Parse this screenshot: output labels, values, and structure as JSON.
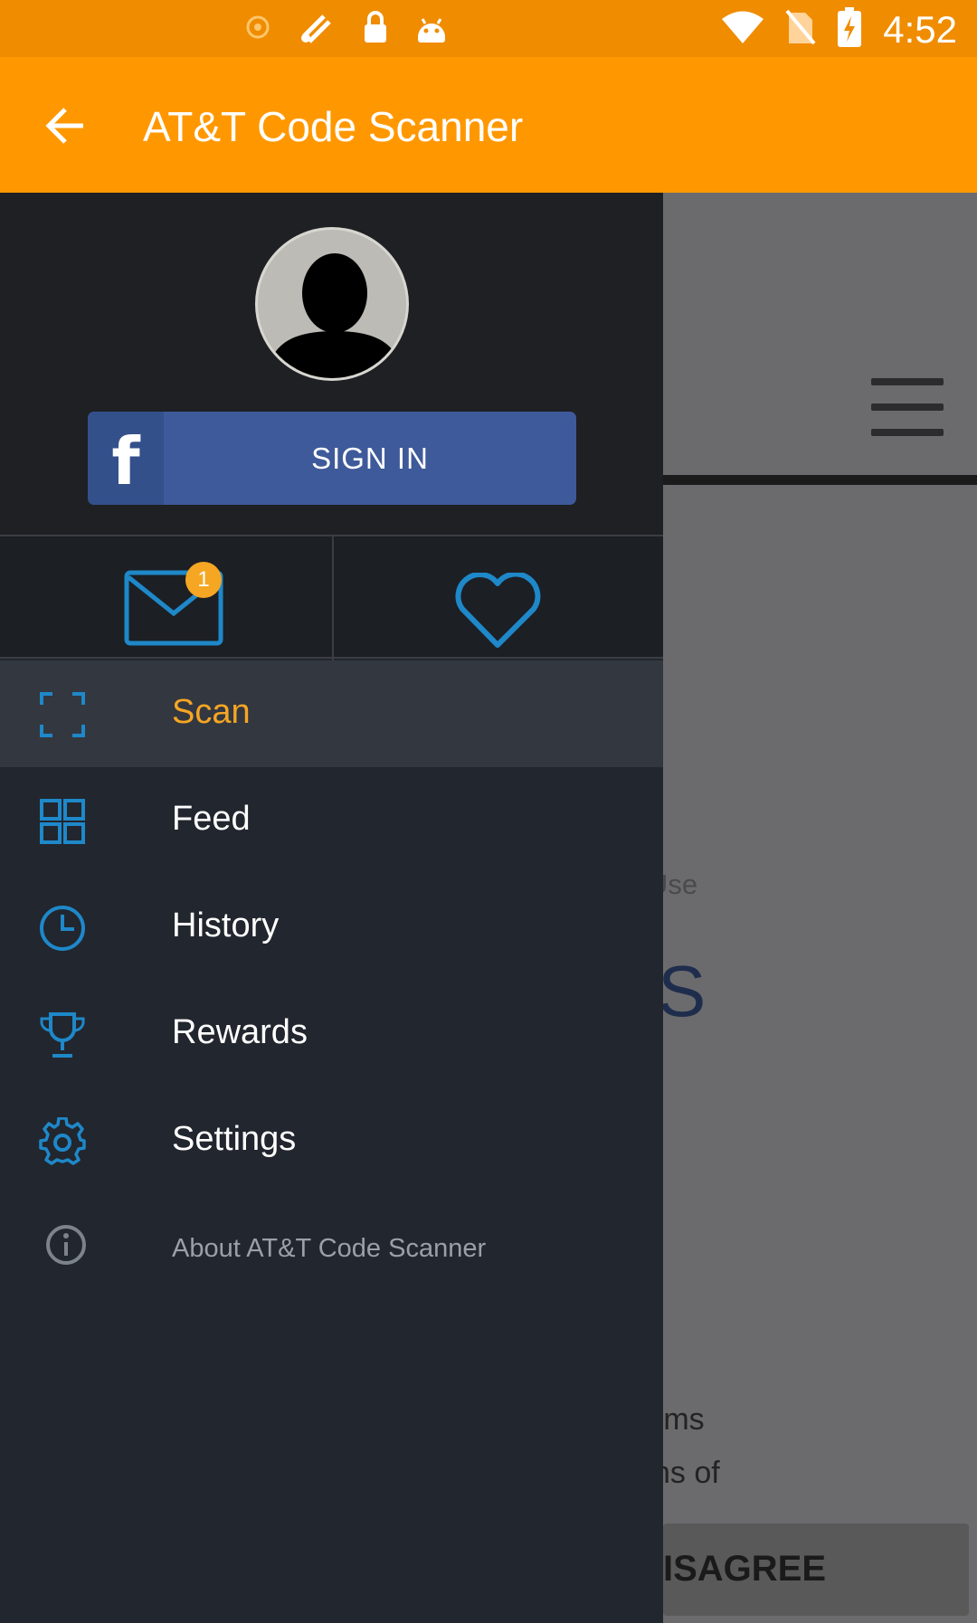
{
  "status_bar": {
    "time": "4:52",
    "icons": [
      "notification-icon",
      "satellite-icon",
      "lock-icon",
      "android-icon",
      "wifi-icon",
      "no-sim-icon",
      "battery-charging-icon"
    ]
  },
  "toolbar": {
    "back_icon": "arrow-left-icon",
    "title": "AT&T Code Scanner"
  },
  "drawer": {
    "avatar_icon": "user-avatar-icon",
    "facebook_button": {
      "icon_letter": "f",
      "label": "SIGN IN"
    },
    "shortcuts": {
      "mail_badge": "1",
      "icons": [
        "mail-icon",
        "heart-icon"
      ]
    },
    "menu": [
      {
        "label": "Scan",
        "icon": "scan-icon",
        "active": true
      },
      {
        "label": "Feed",
        "icon": "grid-icon"
      },
      {
        "label": "History",
        "icon": "clock-icon"
      },
      {
        "label": "Rewards",
        "icon": "trophy-icon"
      },
      {
        "label": "Settings",
        "icon": "gear-icon"
      },
      {
        "label": "About AT&T Code Scanner",
        "icon": "info-icon"
      }
    ],
    "accent_color": "#f5a623",
    "icon_color": "#1e88c9"
  },
  "background_page": {
    "text_partial_1": "Use",
    "text_partial_2": "S",
    "text_partial_3": "rms",
    "text_partial_4": "ns of",
    "button_partial": "ISAGREE"
  }
}
